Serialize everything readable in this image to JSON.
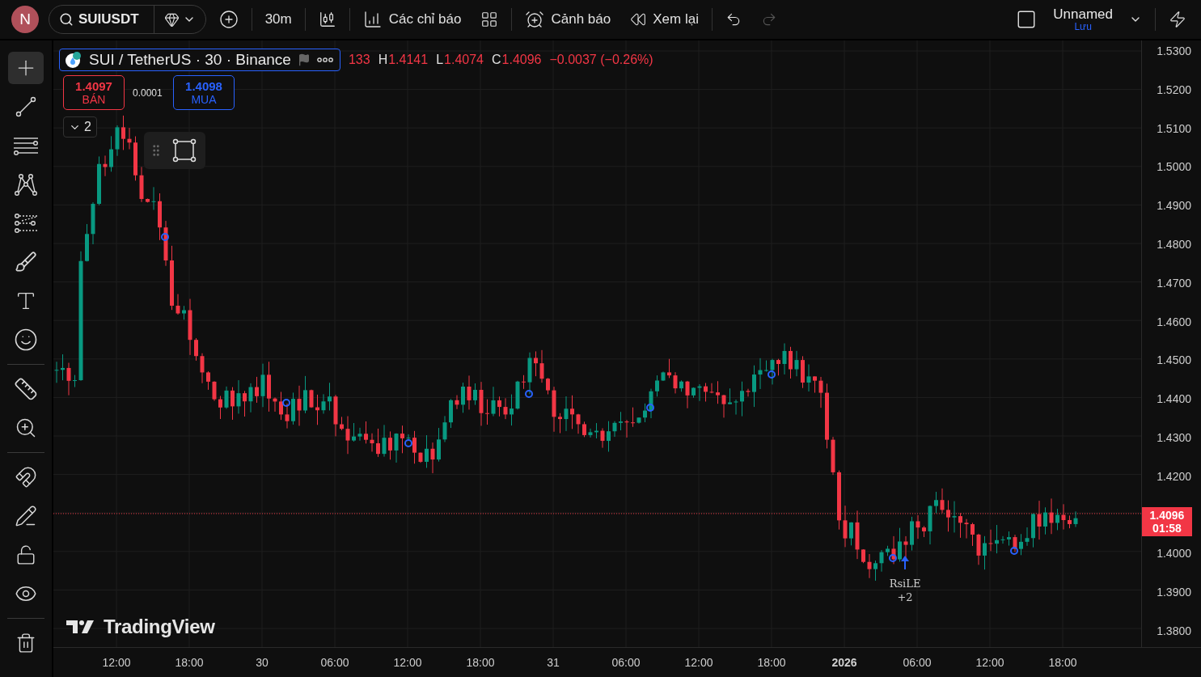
{
  "top_bar": {
    "avatar": "N",
    "symbol": "SUIUSDT",
    "interval": "30m",
    "indicators_label": "Các chỉ báo",
    "alerts_label": "Cảnh báo",
    "replay_label": "Xem lại",
    "redo_disabled": true,
    "layout_name": "Unnamed",
    "layout_save": "Lưu"
  },
  "left_toolbar": {
    "groups": [
      {
        "tools": [
          {
            "kind": "crosshair",
            "selected": true
          },
          {
            "kind": "trend",
            "selected": false
          },
          {
            "kind": "fib",
            "selected": false
          },
          {
            "kind": "pattern",
            "selected": false
          },
          {
            "kind": "forecast",
            "selected": false
          },
          {
            "kind": "brush",
            "selected": false
          },
          {
            "kind": "text",
            "selected": false
          },
          {
            "kind": "emoji",
            "selected": false
          }
        ]
      },
      {
        "tools": [
          {
            "kind": "ruler",
            "selected": false
          },
          {
            "kind": "zoom",
            "selected": false
          }
        ]
      },
      {
        "tools": [
          {
            "kind": "magnet",
            "selected": false
          },
          {
            "kind": "lock_drawing",
            "selected": false
          },
          {
            "kind": "unlock",
            "selected": false
          },
          {
            "kind": "eye",
            "selected": false
          }
        ]
      },
      {
        "tools": [
          {
            "kind": "trash",
            "selected": false
          }
        ]
      }
    ]
  },
  "legend": {
    "title": "SUI / TetherUS · 30 · Binance",
    "ohlc": [
      {
        "value": "133"
      },
      {
        "label": "H",
        "value": "1.4141"
      },
      {
        "label": "L",
        "value": "1.4074"
      },
      {
        "label": "C",
        "value": "1.4096"
      }
    ],
    "change": "−0.0037 (−0.26%)"
  },
  "trade": {
    "sell_price": "1.4097",
    "sell_label": "BÁN",
    "spread": "0.0001",
    "buy_price": "1.4098",
    "buy_label": "MUA"
  },
  "indicators_toggle": "2",
  "signal": {
    "label": "RsiLE",
    "count": "+2"
  },
  "branding": "TradingView",
  "price_axis": {
    "above": [
      "1.5300",
      "1.5200",
      "1.5100",
      "1.5000",
      "1.4900",
      "1.4800",
      "1.4700",
      "1.4600",
      "1.4500",
      "1.4400",
      "1.4300",
      "1.4200"
    ],
    "below": [
      "1.4000",
      "1.3900",
      "1.3800"
    ]
  },
  "current_price": {
    "price": "1.4096",
    "countdown": "01:58"
  },
  "time_axis": [
    {
      "label": "12:00",
      "bold": false
    },
    {
      "label": "18:00",
      "bold": false
    },
    {
      "label": "30",
      "bold": false
    },
    {
      "label": "06:00",
      "bold": false
    },
    {
      "label": "12:00",
      "bold": false
    },
    {
      "label": "18:00",
      "bold": false
    },
    {
      "label": "31",
      "bold": false
    },
    {
      "label": "06:00",
      "bold": false
    },
    {
      "label": "12:00",
      "bold": false
    },
    {
      "label": "18:00",
      "bold": false
    },
    {
      "label": "2026",
      "bold": true
    },
    {
      "label": "06:00",
      "bold": false
    },
    {
      "label": "12:00",
      "bold": false
    },
    {
      "label": "18:00",
      "bold": false
    }
  ]
}
